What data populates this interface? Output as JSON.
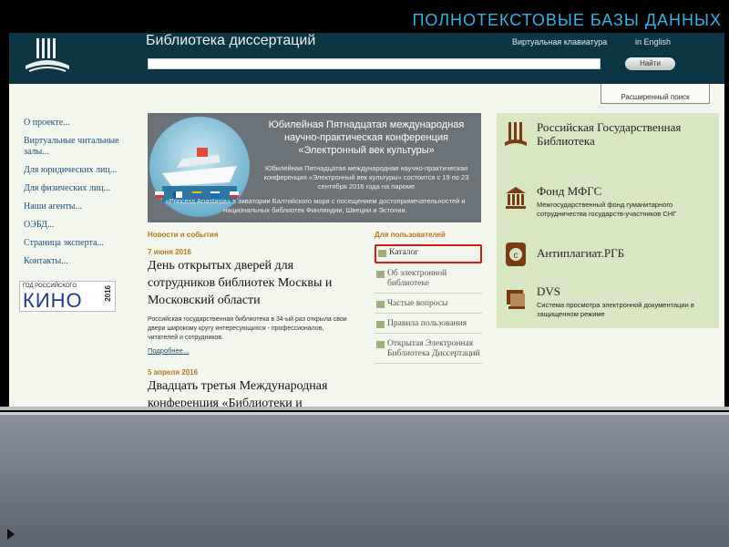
{
  "slide": {
    "title": "ПОЛНОТЕКСТОВЫЕ  БАЗЫ  ДАННЫХ"
  },
  "header": {
    "site_title": "Библиотека диссертаций",
    "virtual_keyboard": "Виртуальная клавиатура",
    "english": "in English",
    "search_placeholder": "",
    "search_button": "Найти",
    "advanced_search": "Расширенный поиск"
  },
  "left_nav": {
    "items": [
      "О проекте...",
      "Виртуальные читальные залы...",
      "Для юридических лиц...",
      "Для физических лиц...",
      "Наши агенты...",
      "ОЭБД...",
      "Страница эксперта...",
      "Контакты..."
    ],
    "kino_badge": {
      "small": "ГОД РОССИЙСКОГО",
      "big": "КИНО",
      "year": "2016"
    }
  },
  "banner": {
    "title": "Юбилейная Пятнадцатая международная научно-практическая конференция «Электронный век культуры»",
    "text": "Юбилейная Пятнадцатая международная научно-практическая конференция «Электронный век культуры» состоится с 19 по 23 сентября 2016 года на пароме",
    "text2": "«Princess Anastasia» в акватории Балтийского моря с посещением достопримечательностей и национальных библиотек Финляндии, Швеции и Эстонии."
  },
  "news": {
    "heading": "Новости и события",
    "items": [
      {
        "date": "7 июня 2016",
        "title": "День открытых дверей для сотрудников библиотек Москвы и Московский области",
        "body": "Российская государственная библиотека в 34-ый раз открыла свои двери широкому кругу интересующихся - профессионалов, читателей и сотрудников.",
        "more": "Подробнее..."
      },
      {
        "date": "5 апреля 2016",
        "title": "Двадцать третья Международная конференция «Библиотеки и"
      }
    ]
  },
  "users": {
    "heading": "Для пользователей",
    "items": [
      "Каталог",
      "Об электронной библиотеке",
      "Частые вопросы",
      "Правила пользования",
      "Открытая Электронная Библиотека Диссертаций"
    ]
  },
  "right_panel": {
    "items": [
      {
        "title": "Российская Государственная Библиотека",
        "sub": ""
      },
      {
        "title": "Фонд МФГС",
        "sub": "Межгосударственный фонд гуманитарного сотрудничества государств-участников СНГ"
      },
      {
        "title": "Антиплагиат.РГБ",
        "sub": ""
      },
      {
        "title": "DVS",
        "sub": "Система просмотра электронной документации в защищенном режиме"
      }
    ]
  },
  "colors": {
    "header_bg": "#0d3645",
    "page_bg": "#f2f6ec",
    "link": "#1c4f7a",
    "accent_orange": "#b7771c",
    "highlight_red": "#d11c1c",
    "panel_green": "#d9e6c4"
  }
}
